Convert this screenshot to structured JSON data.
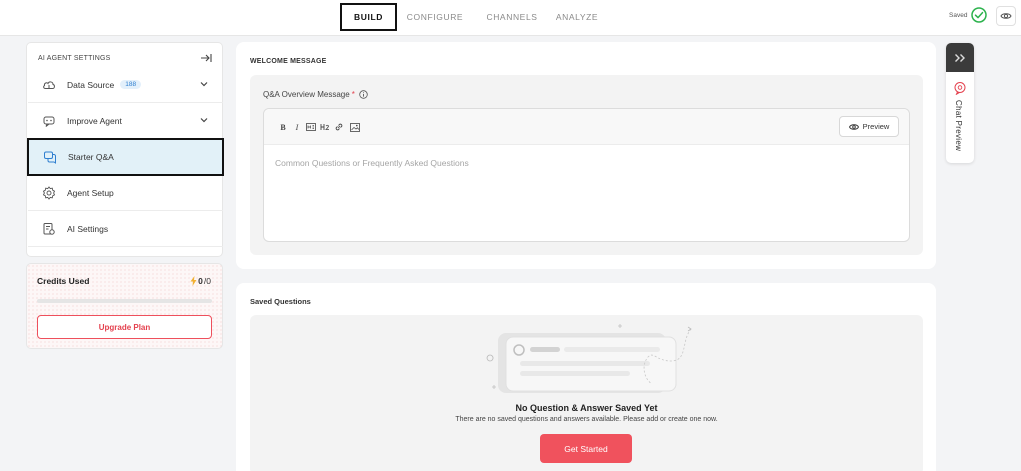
{
  "top_nav": {
    "tabs": [
      {
        "label": "BUILD",
        "active": true
      },
      {
        "label": "CONFIGURE",
        "active": false
      },
      {
        "label": "CHANNELS",
        "active": false
      },
      {
        "label": "ANALYZE",
        "active": false
      }
    ],
    "saved_label": "Saved",
    "saved_icon": "check-circle-icon",
    "view_icon": "eye-icon"
  },
  "sidebar": {
    "heading": "AI AGENT SETTINGS",
    "collapse_icon": "collapse-right-icon",
    "items": [
      {
        "label": "Data Source",
        "badge": "188",
        "icon": "database-icon",
        "expandable": true
      },
      {
        "label": "Improve Agent",
        "icon": "chat-robot-icon",
        "expandable": true
      },
      {
        "label": "Starter Q&A",
        "icon": "qa-chat-icon",
        "active": true
      },
      {
        "label": "Agent Setup",
        "icon": "gear-icon"
      },
      {
        "label": "AI Settings",
        "icon": "ai-settings-icon"
      }
    ]
  },
  "credits": {
    "title": "Credits Used",
    "used": "0",
    "total": "/0",
    "used_fraction": 0,
    "upgrade_label": "Upgrade Plan"
  },
  "welcome": {
    "title": "WELCOME MESSAGE",
    "field_label": "Q&A Overview Message",
    "required_mark": "*",
    "toolbar": [
      "bold-icon",
      "italic-icon",
      "heading1-icon",
      "heading2-icon",
      "link-icon",
      "image-icon"
    ],
    "preview_label": "Preview",
    "placeholder": "Common Questions or Frequently Asked Questions"
  },
  "saved_questions": {
    "title": "Saved Questions",
    "empty_title": "No Question & Answer Saved Yet",
    "empty_subtitle": "There are no saved questions and answers available. Please add or create one now.",
    "cta_label": "Get Started"
  },
  "chat_preview": {
    "label": "Chat Preview",
    "expand_icon": "double-chevron-right-icon",
    "icon": "chat-bubble-icon"
  },
  "colors": {
    "accent": "#f0525d",
    "active_bg": "#e2f1f8",
    "badge_text": "#2f7fd0",
    "saved_check": "#2bb24c"
  }
}
